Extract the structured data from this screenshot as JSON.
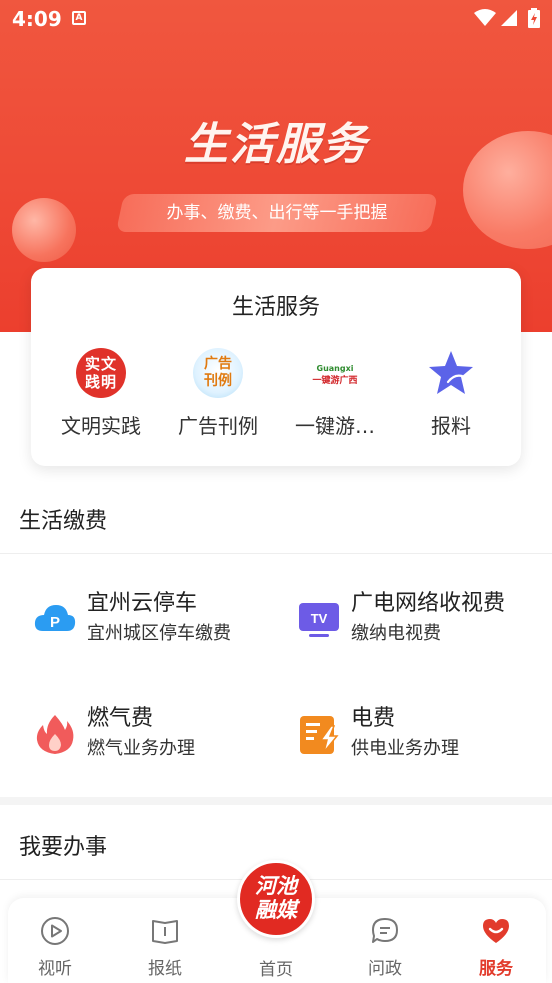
{
  "status_bar": {
    "time": "4:09",
    "notif_icon": "A"
  },
  "hero": {
    "title": "生活服务",
    "subtitle": "办事、缴费、出行等一手把握"
  },
  "service_card": {
    "title": "生活服务",
    "items": [
      {
        "label": "文明实践",
        "icon_text_1": "实文",
        "icon_text_2": "践明"
      },
      {
        "label": "广告刊例",
        "icon_text_1": "广告",
        "icon_text_2": "刊例"
      },
      {
        "label": "一键游…",
        "icon_text_top": "Guangxi",
        "icon_text_bottom": "一键游广西"
      },
      {
        "label": "报料"
      }
    ]
  },
  "payments": {
    "heading": "生活缴费",
    "items": [
      {
        "name": "宜州云停车",
        "desc": "宜州城区停车缴费",
        "icon": "parking-cloud-icon"
      },
      {
        "name": "广电网络收视费",
        "desc": "缴纳电视费",
        "icon": "tv-icon"
      },
      {
        "name": "燃气费",
        "desc": "燃气业务办理",
        "icon": "flame-icon"
      },
      {
        "name": "电费",
        "desc": "供电业务办理",
        "icon": "electricity-icon"
      }
    ]
  },
  "affairs": {
    "heading": "我要办事"
  },
  "nav": {
    "items": [
      {
        "label": "视听"
      },
      {
        "label": "报纸"
      },
      {
        "label": "首页",
        "logo_line1": "河池",
        "logo_line2": "融媒"
      },
      {
        "label": "问政"
      },
      {
        "label": "服务"
      }
    ],
    "active_color": "#e23b2c"
  },
  "colors": {
    "brand": "#ee4a36",
    "accent_red": "#e23b2c"
  }
}
